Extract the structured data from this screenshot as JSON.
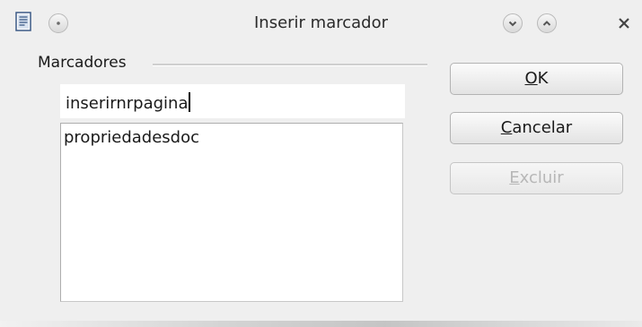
{
  "window": {
    "title": "Inserir marcador"
  },
  "titlebar": {
    "icons": [
      "document-icon",
      "menu-icon",
      "minimize-icon",
      "maximize-icon",
      "close-icon"
    ]
  },
  "bookmarks": {
    "group_label": "Marcadores",
    "input_value": "inserirnrpagina",
    "items": [
      {
        "label": "propriedadesdoc"
      }
    ]
  },
  "buttons": {
    "ok": {
      "label": "OK",
      "mnemonic": "O",
      "rest": "K"
    },
    "cancel": {
      "label": "Cancelar",
      "mnemonic": "C",
      "rest": "ancelar"
    },
    "delete": {
      "label": "Excluir",
      "mnemonic": "E",
      "rest": "xcluir",
      "enabled": false
    }
  }
}
